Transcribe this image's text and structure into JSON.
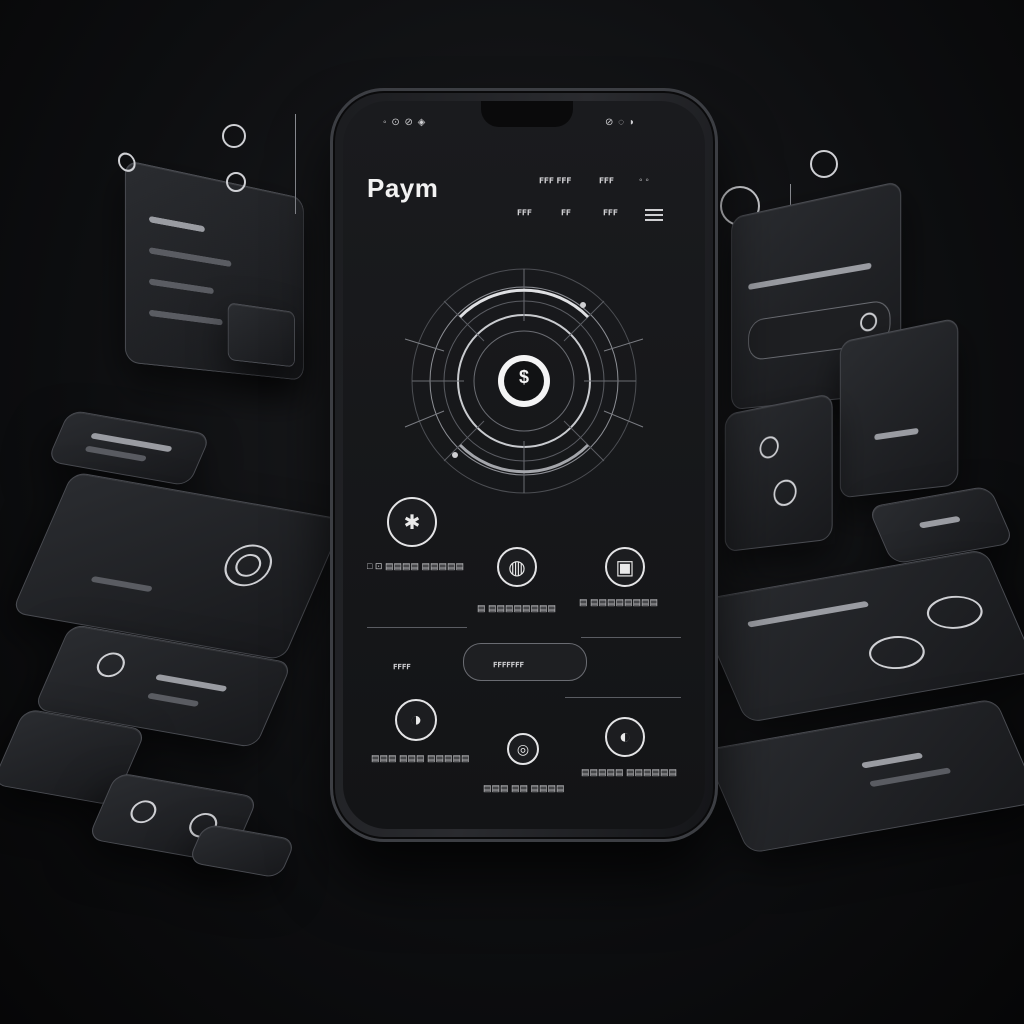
{
  "app": {
    "brand": "Paym",
    "center_icon": "$"
  },
  "status_bar": {
    "left": "◦ ⊙ ⊘ ◈",
    "right": "⊘ ◌ ◗"
  },
  "nav": {
    "items": [
      "ꜰꜰꜰ ꜰꜰꜰ",
      "ꜰꜰꜰ",
      "◦ ◦"
    ],
    "tabs": [
      "ꜰꜰꜰ",
      "ꜰꜰ",
      "ꜰꜰꜰ"
    ]
  },
  "features": [
    {
      "icon": "puzzle-icon",
      "glyph": "✱",
      "label": "□ ⊡ ▤▤▤▤ ▤▤▤▤▤"
    },
    {
      "icon": "shield-icon",
      "glyph": "◍",
      "label": "▤ ▤▤▤▤▤▤▤▤"
    },
    {
      "icon": "card-icon",
      "glyph": "▣",
      "label": "▤ ▤▤▤▤▤▤▤▤"
    },
    {
      "icon": "wallet-icon",
      "glyph": "◑",
      "label": "▤▤▤ ▤▤▤ ▤▤▤▤▤"
    },
    {
      "icon": "user-icon",
      "glyph": "◎",
      "label": "▤▤▤ ▤▤ ▤▤▤▤"
    },
    {
      "icon": "globe-icon",
      "glyph": "◐",
      "label": "▤▤▤▤▤ ▤▤▤▤▤▤"
    }
  ],
  "section_labels": {
    "left": "ꜰꜰꜰꜰ",
    "center": "ꜰꜰꜰꜰꜰꜰꜰ"
  },
  "colors": {
    "background": "#0d0e10",
    "panel": "#1e2024",
    "accent": "#f2f2f2"
  }
}
